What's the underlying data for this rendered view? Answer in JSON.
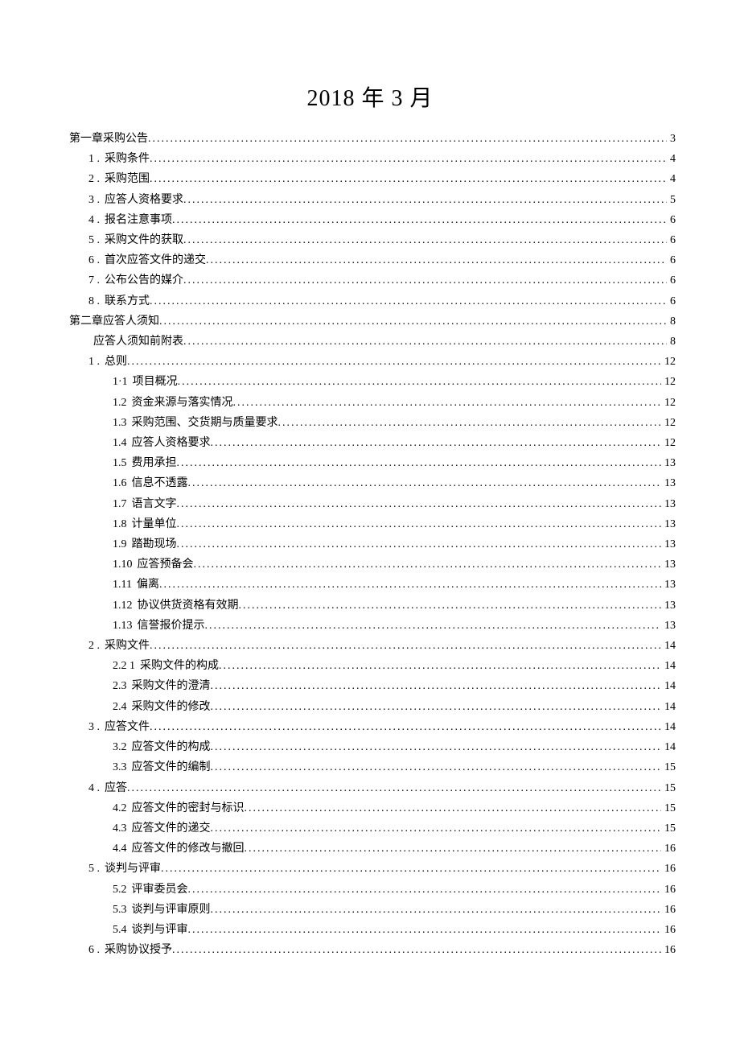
{
  "title": "2018 年 3 月",
  "toc": [
    {
      "level": 0,
      "num": "",
      "label": "第一章采购公告",
      "page": "3"
    },
    {
      "level": 1,
      "num": "1  .",
      "label": "采购条件",
      "page": "4"
    },
    {
      "level": 1,
      "num": "2  .",
      "label": "采购范围",
      "page": "4"
    },
    {
      "level": 1,
      "num": "3  .",
      "label": "应答人资格要求",
      "page": "5"
    },
    {
      "level": 1,
      "num": "4  .",
      "label": "报名注意事项",
      "page": "6"
    },
    {
      "level": 1,
      "num": "5  .",
      "label": "采购文件的获取",
      "page": "6"
    },
    {
      "level": 1,
      "num": "6  .",
      "label": "首次应答文件的递交",
      "page": "6"
    },
    {
      "level": 1,
      "num": "7  .",
      "label": "公布公告的媒介",
      "page": "6"
    },
    {
      "level": 1,
      "num": "8   .",
      "label": "联系方式",
      "page": "6"
    },
    {
      "level": 0,
      "num": "",
      "label": "第二章应答人须知",
      "page": "8"
    },
    {
      "level": 1,
      "num": "",
      "label": "应答人须知前附表",
      "page": "8"
    },
    {
      "level": 1,
      "num": "1  .",
      "label": "总则",
      "page": "12"
    },
    {
      "level": 2,
      "num": "1·1",
      "label": "项目概况",
      "page": "12"
    },
    {
      "level": 2,
      "num": "1.2    ",
      "label": "资金来源与落实情况",
      "page": "12"
    },
    {
      "level": 2,
      "num": "1.3    ",
      "label": "采购范围、交货期与质量要求",
      "page": "12"
    },
    {
      "level": 2,
      "num": "1.4    ",
      "label": "应答人资格要求",
      "page": "12"
    },
    {
      "level": 2,
      "num": "1.5    ",
      "label": "费用承担",
      "page": "13"
    },
    {
      "level": 2,
      "num": "1.6    ",
      "label": "信息不透露",
      "page": "13"
    },
    {
      "level": 2,
      "num": "1.7    ",
      "label": "语言文字",
      "page": "13"
    },
    {
      "level": 2,
      "num": "1.8    ",
      "label": "计量单位",
      "page": "13"
    },
    {
      "level": 2,
      "num": "1.9    ",
      "label": "踏勘现场",
      "page": "13"
    },
    {
      "level": 2,
      "num": "1.10    ",
      "label": "应答预备会",
      "page": "13"
    },
    {
      "level": 2,
      "num": "1.11    ",
      "label": "偏离",
      "page": "13"
    },
    {
      "level": 2,
      "num": "1.12    ",
      "label": "协议供货资格有效期",
      "page": "13"
    },
    {
      "level": 2,
      "num": "1.13    ",
      "label": "信誉报价提示",
      "page": "13"
    },
    {
      "level": 1,
      "num": "2   .",
      "label": "采购文件",
      "page": "14"
    },
    {
      "level": 2,
      "num": "2.2  1",
      "label": "采购文件的构成",
      "page": "14"
    },
    {
      "level": 2,
      "num": "2.3   ",
      "label": "采购文件的澄清",
      "page": "14"
    },
    {
      "level": 2,
      "num": "2.4   ",
      "label": "采购文件的修改",
      "page": "14"
    },
    {
      "level": 1,
      "num": "3   .",
      "label": "应答文件",
      "page": "14"
    },
    {
      "level": 2,
      "num": "3.2    ",
      "label": "应答文件的构成",
      "page": "14"
    },
    {
      "level": 2,
      "num": "3.3    ",
      "label": "应答文件的编制",
      "page": "15"
    },
    {
      "level": 1,
      "num": "4   .",
      "label": "应答",
      "page": "15"
    },
    {
      "level": 2,
      "num": "4.2    ",
      "label": "应答文件的密封与标识",
      "page": "15"
    },
    {
      "level": 2,
      "num": "4.3    ",
      "label": "应答文件的递交",
      "page": "15"
    },
    {
      "level": 2,
      "num": "4.4    ",
      "label": "应答文件的修改与撤回",
      "page": "16"
    },
    {
      "level": 1,
      "num": "5   .",
      "label": "谈判与评审",
      "page": "16"
    },
    {
      "level": 2,
      "num": "5.2    ",
      "label": "评审委员会",
      "page": "16"
    },
    {
      "level": 2,
      "num": "5.3    ",
      "label": "谈判与评审原则",
      "page": "16"
    },
    {
      "level": 2,
      "num": "5.4    ",
      "label": "谈判与评审",
      "page": "16"
    },
    {
      "level": 1,
      "num": "6   .",
      "label": "采购协议授予",
      "page": "16"
    }
  ]
}
